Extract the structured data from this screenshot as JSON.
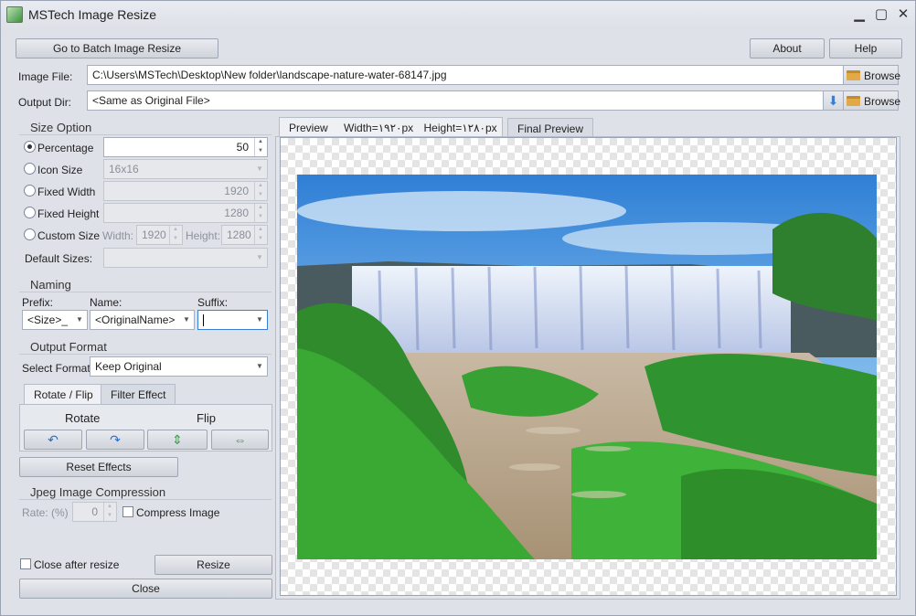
{
  "window": {
    "title": "MSTech Image Resize"
  },
  "toolbar": {
    "batch_label": "Go to Batch Image Resize",
    "about_label": "About",
    "help_label": "Help"
  },
  "image_file": {
    "label": "Image File:",
    "value": "C:\\Users\\MSTech\\Desktop\\New folder\\landscape-nature-water-68147.jpg",
    "browse_label": "Browse"
  },
  "output_dir": {
    "label": "Output Dir:",
    "value": "<Same as Original File>",
    "browse_label": "Browse"
  },
  "size_option": {
    "heading": "Size Option",
    "percentage_label": "Percentage",
    "percentage_value": "50",
    "icon_size_label": "Icon Size",
    "icon_size_value": "16x16",
    "fixed_width_label": "Fixed Width",
    "fixed_width_value": "1920",
    "fixed_height_label": "Fixed Height",
    "fixed_height_value": "1280",
    "custom_size_label": "Custom Size",
    "custom_width_label": "Width:",
    "custom_width_value": "1920",
    "custom_height_label": "Height:",
    "custom_height_value": "1280",
    "default_sizes_label": "Default Sizes:"
  },
  "naming": {
    "heading": "Naming",
    "prefix_label": "Prefix:",
    "prefix_value": "<Size>_",
    "name_label": "Name:",
    "name_value": "<OriginalName>",
    "suffix_label": "Suffix:",
    "suffix_value": ""
  },
  "output_format": {
    "heading": "Output Format",
    "select_label": "Select Format:",
    "select_value": "Keep Original"
  },
  "effects": {
    "tab_rotate": "Rotate / Flip",
    "tab_filter": "Filter Effect",
    "rotate_label": "Rotate",
    "flip_label": "Flip",
    "reset_label": "Reset Effects"
  },
  "jpeg": {
    "heading": "Jpeg Image Compression",
    "rate_label": "Rate: (%)",
    "rate_value": "0",
    "compress_label": "Compress Image"
  },
  "footer": {
    "close_after_label": "Close after resize",
    "resize_label": "Resize",
    "close_label": "Close"
  },
  "preview": {
    "tab_preview": "Preview",
    "width_text": "Width=۱۹۲۰px",
    "height_text": "Height=۱۲۸۰px",
    "tab_final": "Final Preview"
  },
  "colors": {
    "accent_arrow": "#3a7fd0",
    "folder": "#e1a948",
    "window_bg": "#dee1e8"
  }
}
